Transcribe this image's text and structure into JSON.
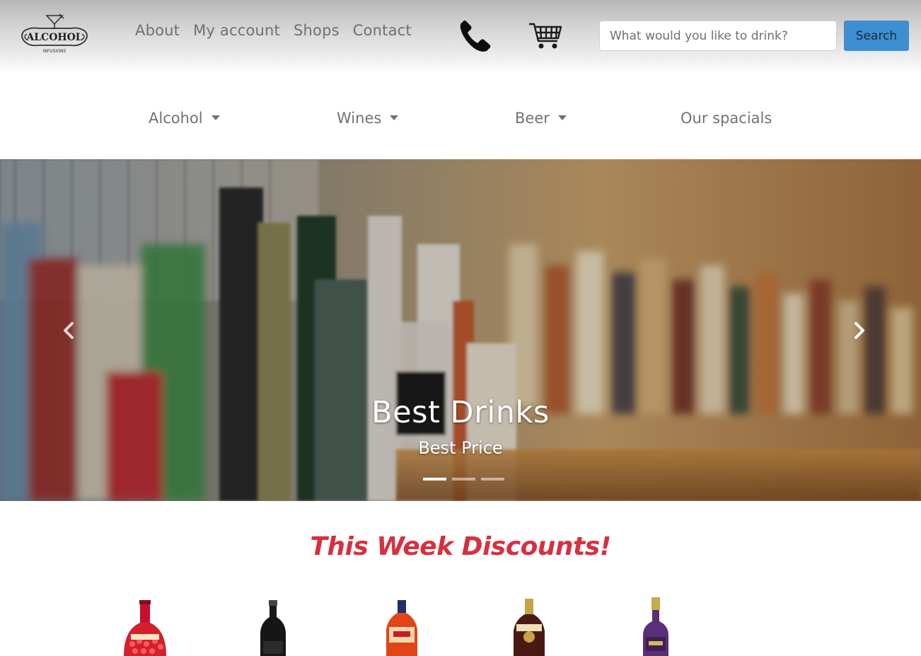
{
  "header": {
    "logo_text": "ALCOHOL",
    "logo_subtext": "INFUSIONS",
    "nav": [
      {
        "label": "About"
      },
      {
        "label": "My account"
      },
      {
        "label": "Shops"
      },
      {
        "label": "Contact"
      }
    ],
    "icons": [
      "phone-icon",
      "cart-icon"
    ],
    "search": {
      "placeholder": "What would you like to drink?",
      "value": "",
      "button_label": "Search"
    },
    "colors": {
      "search_button": "#3d8fd1"
    }
  },
  "categories": [
    {
      "label": "Alcohol",
      "dropdown": true
    },
    {
      "label": "Wines",
      "dropdown": true
    },
    {
      "label": "Beer",
      "dropdown": true
    },
    {
      "label": "Our spacials",
      "dropdown": false
    }
  ],
  "carousel": {
    "title": "Best Drinks",
    "subtitle": "Best Price",
    "slides": 3,
    "active_slide": 1,
    "controls": [
      "chevron-left-icon",
      "chevron-right-icon"
    ]
  },
  "discounts": {
    "title": "This Week Discounts!",
    "title_color": "#d6303f",
    "products": [
      {
        "icon": "red-liqueur-bottle-icon"
      },
      {
        "icon": "red-wine-bottle-icon"
      },
      {
        "icon": "orange-liqueur-bottle-icon"
      },
      {
        "icon": "dark-rum-bottle-icon"
      },
      {
        "icon": "purple-liqueur-bottle-icon"
      }
    ]
  }
}
